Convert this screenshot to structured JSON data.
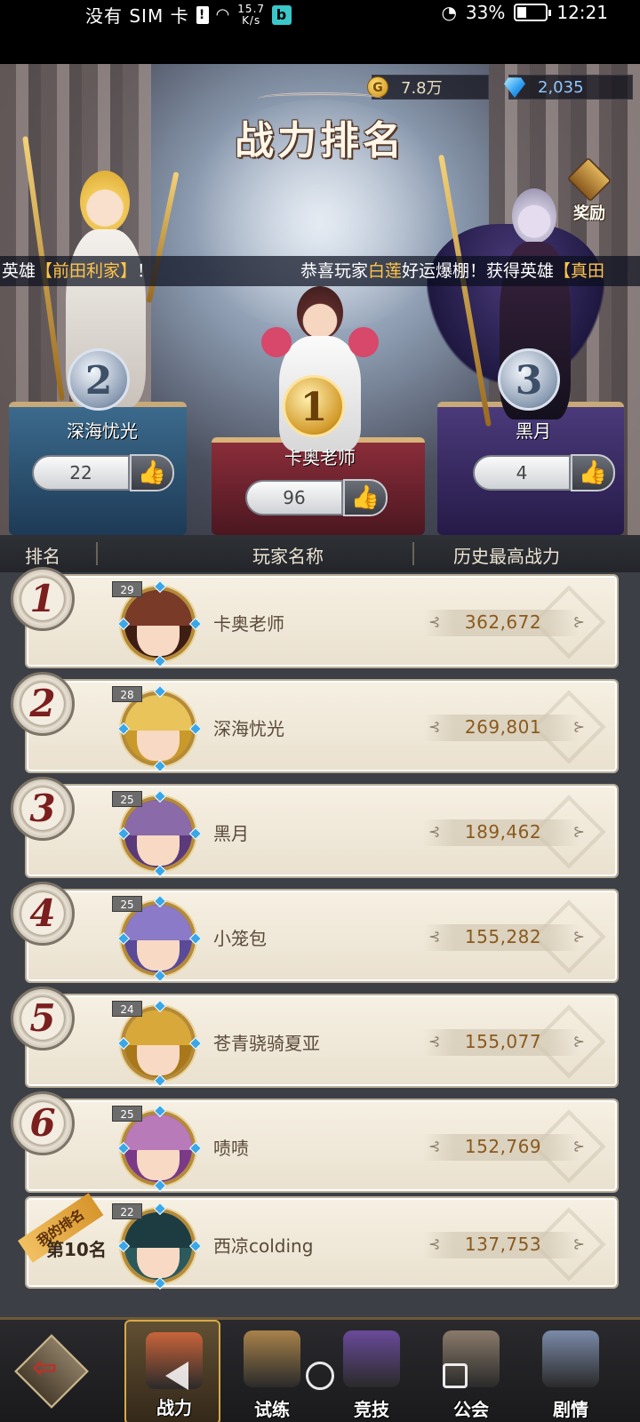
{
  "status_bar": {
    "carrier": "没有 SIM 卡",
    "net_speed_value": "15.7",
    "net_speed_unit": "K/s",
    "battery_percent": "33%",
    "battery_level": 0.33,
    "time": "12:21"
  },
  "currency": {
    "gold_icon": "G",
    "gold": "7.8万",
    "gems": "2,035"
  },
  "title": "战力排名",
  "reward_label": "奖励",
  "marquee": {
    "a_prefix": "英雄",
    "a_hero": "【前田利家】",
    "a_suffix": "！",
    "b_prefix": "恭喜玩家",
    "b_player": "白莲",
    "b_middle": "好运爆棚！获得英雄",
    "b_hero": "【真田"
  },
  "podium": {
    "first": {
      "rank": "1",
      "name": "卡奥老师",
      "likes": "96"
    },
    "second": {
      "rank": "2",
      "name": "深海忧光",
      "likes": "22"
    },
    "third": {
      "rank": "3",
      "name": "黑月",
      "likes": "4"
    }
  },
  "table": {
    "headers": {
      "rank": "排名",
      "name": "玩家名称",
      "power": "历史最高战力"
    },
    "rows": [
      {
        "rank": "1",
        "level": "29",
        "name": "卡奥老师",
        "power": "362,672"
      },
      {
        "rank": "2",
        "level": "28",
        "name": "深海忧光",
        "power": "269,801"
      },
      {
        "rank": "3",
        "level": "25",
        "name": "黑月",
        "power": "189,462"
      },
      {
        "rank": "4",
        "level": "25",
        "name": "小笼包",
        "power": "155,282"
      },
      {
        "rank": "5",
        "level": "24",
        "name": "苍青骁骑夏亚",
        "power": "155,077"
      },
      {
        "rank": "6",
        "level": "25",
        "name": "啧啧",
        "power": "152,769"
      }
    ],
    "my_row": {
      "ribbon": "我的排名",
      "rank_text": "第10名",
      "level": "22",
      "name": "西凉colding",
      "power": "137,753"
    }
  },
  "nav": {
    "items": [
      {
        "label": "战力",
        "icon": "power-icon"
      },
      {
        "label": "试练",
        "icon": "scroll-icon"
      },
      {
        "label": "竞技",
        "icon": "banner-icon"
      },
      {
        "label": "公会",
        "icon": "guild-icon"
      },
      {
        "label": "剧情",
        "icon": "book-icon"
      }
    ]
  },
  "colors": {
    "highlight": "#ffc54a",
    "power_text": "#8a5a1e",
    "rank_number": "#7a1e1e"
  }
}
